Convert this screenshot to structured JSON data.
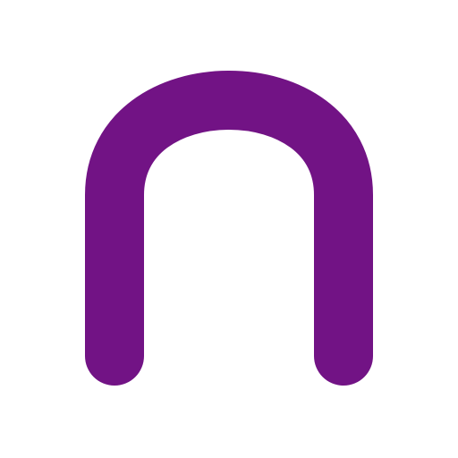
{
  "logo": {
    "icon": "arch-n-icon",
    "color": "#721385",
    "background": "#ffffff"
  }
}
